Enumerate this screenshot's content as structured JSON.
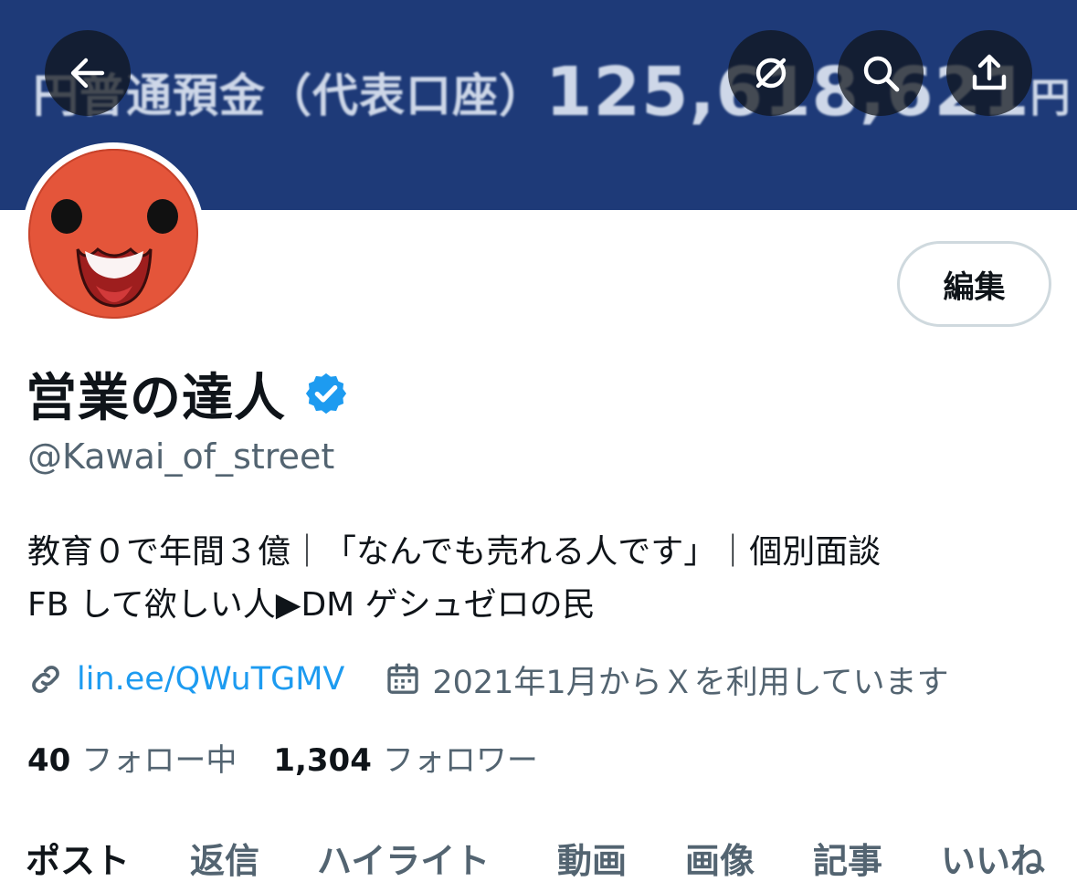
{
  "banner": {
    "text_main": "円普通預金（代表口座）",
    "text_amount": "125,618,621",
    "text_unit": "円"
  },
  "nav": {
    "back_icon": "arrow-left-icon",
    "hide_icon": "eye-slash-icon",
    "search_icon": "search-icon",
    "share_icon": "share-icon"
  },
  "profile": {
    "edit_label": "編集",
    "display_name": "営業の達人",
    "verified_icon": "verified-badge-icon",
    "handle": "@Kawai_of_street",
    "bio_line1": "教育０で年間３億｜「なんでも売れる人です」｜個別面談",
    "bio_line2": "FB して欲しい人▶DM ゲシュゼロの民",
    "link": "lin.ee/QWuTGMV",
    "joined": "2021年1月からＸを利用しています"
  },
  "stats": {
    "following_count": "40",
    "following_label": "フォロー中",
    "followers_count": "1,304",
    "followers_label": "フォロワー"
  },
  "tabs": [
    {
      "label": "ポスト",
      "active": true
    },
    {
      "label": "返信",
      "active": false
    },
    {
      "label": "ハイライト",
      "active": false
    },
    {
      "label": "動画",
      "active": false
    },
    {
      "label": "画像",
      "active": false
    },
    {
      "label": "記事",
      "active": false
    },
    {
      "label": "いいね",
      "active": false
    }
  ],
  "colors": {
    "banner": "#1e3a78",
    "accent": "#1d9bf0",
    "secondary_text": "#536471",
    "primary_text": "#0f1419",
    "avatar": "#e4553a"
  }
}
